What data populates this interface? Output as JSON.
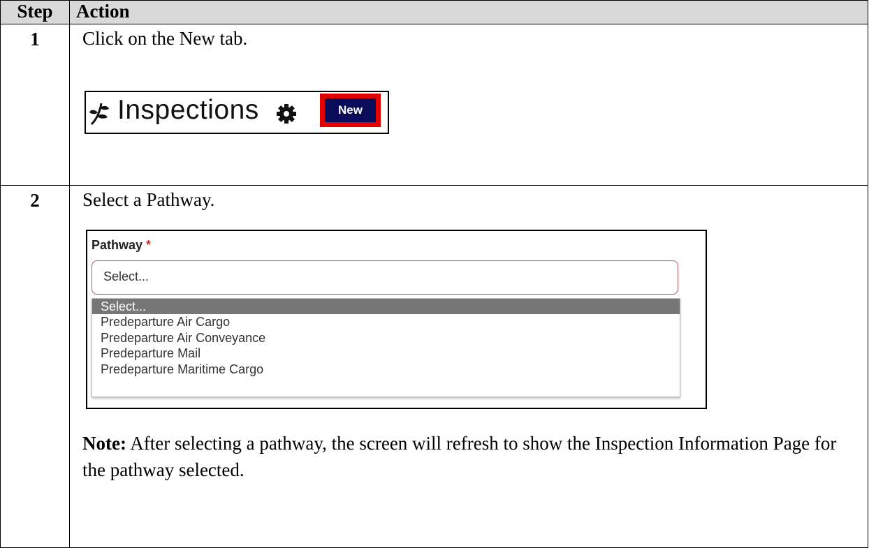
{
  "table": {
    "headers": {
      "step": "Step",
      "action": "Action"
    },
    "step1": {
      "number": "1",
      "instruction": "Click on the New tab.",
      "screenshot": {
        "title": "Inspections",
        "leaf_icon": "leaf-icon",
        "settings_icon": "gear-icon",
        "new_button": "New",
        "highlight_color": "#e00000",
        "button_color": "#0b0b5c"
      }
    },
    "step2": {
      "number": "2",
      "instruction": "Select a Pathway.",
      "screenshot": {
        "field_label": "Pathway",
        "required_marker": "*",
        "select_value": "Select...",
        "options": [
          "Select...",
          "Predeparture Air Cargo",
          "Predeparture Air Conveyance",
          "Predeparture Mail",
          "Predeparture Maritime Cargo"
        ],
        "selected_option": "Select..."
      },
      "note_label": "Note:",
      "note_text": "After selecting a pathway, the screen will refresh to show the Inspection Information Page for the pathway selected."
    }
  }
}
